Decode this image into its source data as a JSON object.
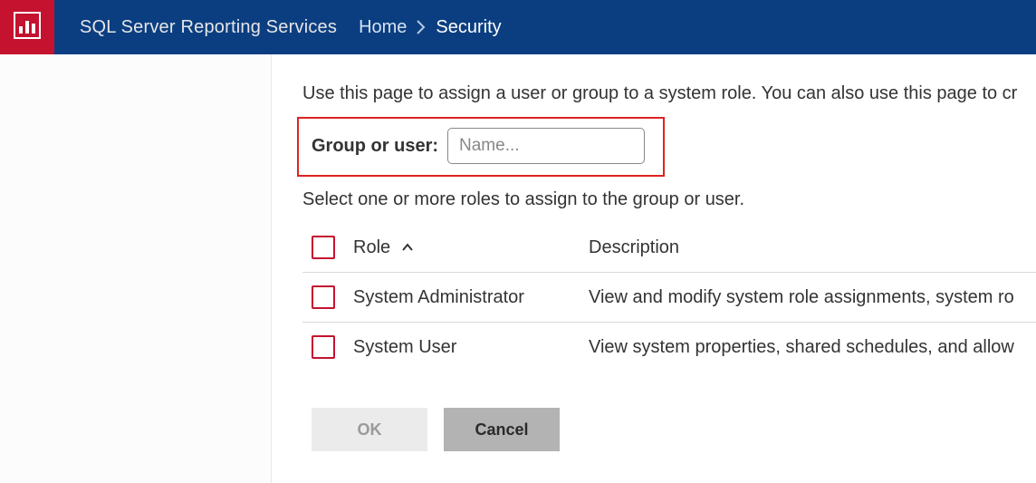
{
  "header": {
    "app_title": "SQL Server Reporting Services",
    "breadcrumb": {
      "home": "Home",
      "current": "Security"
    }
  },
  "main": {
    "intro": "Use this page to assign a user or group to a system role. You can also use this page to cr",
    "group_or_user_label": "Group or user:",
    "name_placeholder": "Name...",
    "select_roles_text": "Select one or more roles to assign to the group or user.",
    "columns": {
      "role": "Role",
      "description": "Description"
    },
    "roles": [
      {
        "name": "System Administrator",
        "description": "View and modify system role assignments, system ro"
      },
      {
        "name": "System User",
        "description": "View system properties, shared schedules, and allow"
      }
    ],
    "buttons": {
      "ok": "OK",
      "cancel": "Cancel"
    }
  },
  "colors": {
    "header_bg": "#0b3e81",
    "brand_red": "#c4122f",
    "highlight_red": "#e02222"
  }
}
